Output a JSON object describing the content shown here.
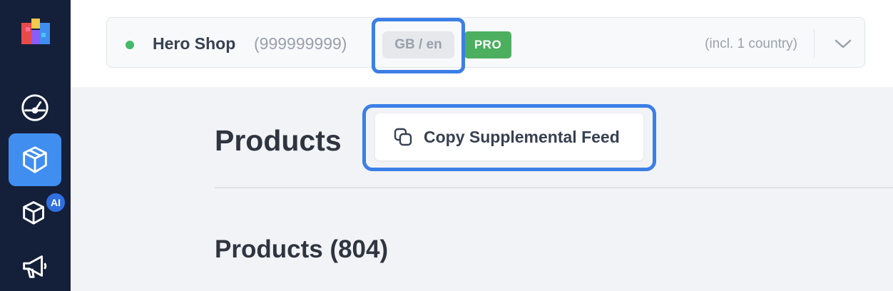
{
  "shop": {
    "status": "online",
    "name": "Hero Shop",
    "id": "(999999999)",
    "locale": "GB / en",
    "plan_badge": "PRO",
    "country_note": "(incl. 1 country)"
  },
  "sidebar": {
    "items": [
      {
        "icon": "dashboard-gauge-icon",
        "active": false
      },
      {
        "icon": "products-box-icon",
        "active": true
      },
      {
        "icon": "ai-products-box-icon",
        "badge": "AI",
        "active": false
      },
      {
        "icon": "megaphone-icon",
        "active": false
      }
    ]
  },
  "page": {
    "title": "Products",
    "copy_button_label": "Copy Supplemental Feed",
    "products_heading": "Products (804)"
  },
  "colors": {
    "sidebar_bg": "#14203a",
    "active_accent": "#3f8ef0",
    "highlight": "#3b7fe6",
    "pro_badge": "#4caf60",
    "status_dot": "#43b96a"
  }
}
